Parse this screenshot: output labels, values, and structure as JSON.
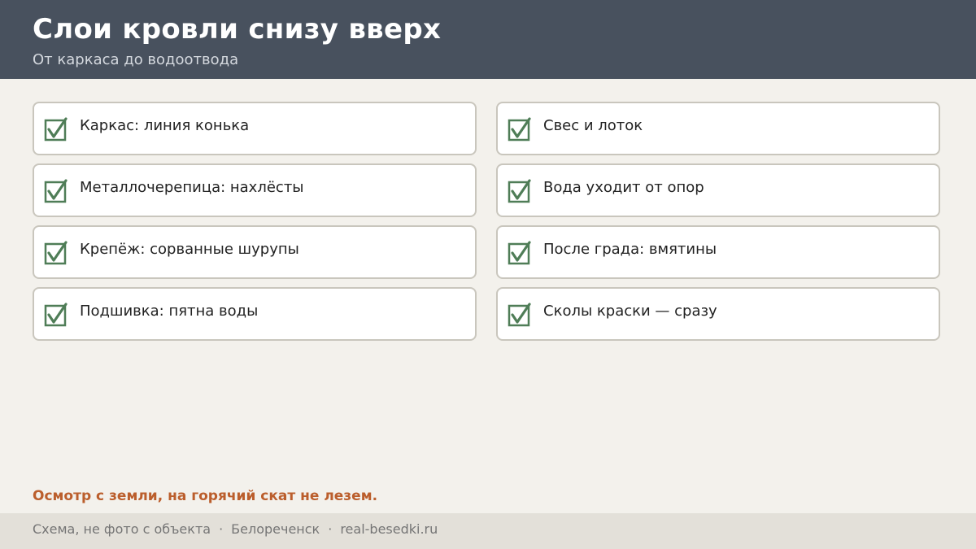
{
  "header": {
    "title": "Слои кровли снизу вверх",
    "subtitle": "От каркаса до водоотвода"
  },
  "checklist": {
    "left": [
      {
        "label": "Каркас: линия конька",
        "checked": true
      },
      {
        "label": "Металлочерепица: нахлёсты",
        "checked": true
      },
      {
        "label": "Крепёж: сорванные шурупы",
        "checked": true
      },
      {
        "label": "Подшивка: пятна воды",
        "checked": true
      }
    ],
    "right": [
      {
        "label": "Свес и лоток",
        "checked": true
      },
      {
        "label": "Вода уходит от опор",
        "checked": true
      },
      {
        "label": "После града: вмятины",
        "checked": true
      },
      {
        "label": "Сколы краски — сразу",
        "checked": true
      }
    ]
  },
  "note": "Осмотр с земли, на горячий скат не лезем.",
  "footer": {
    "part1": "Схема, не фото с объекта",
    "separator": "·",
    "part2": "Белореченск",
    "part3": "real-besedki.ru"
  },
  "colors": {
    "header_bg": "#48515e",
    "page_bg": "#f3f1ec",
    "check_green": "#4f7d57",
    "note_accent": "#bb5e2c",
    "footer_bg": "#e3e0d9"
  }
}
